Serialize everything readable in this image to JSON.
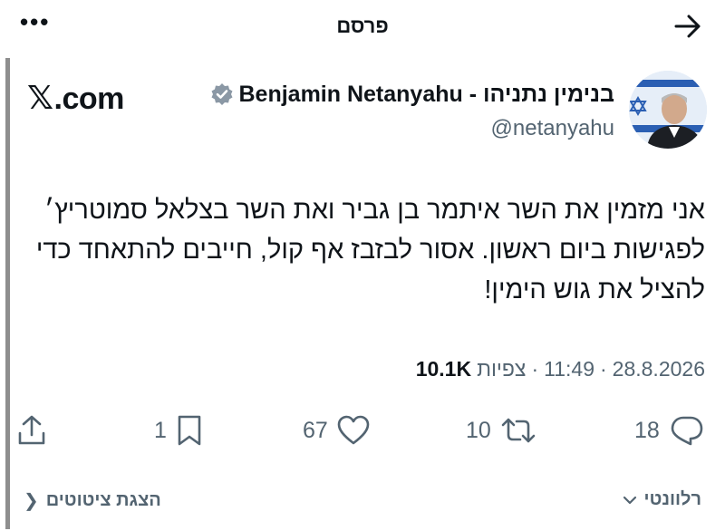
{
  "header": {
    "title": "פרסם",
    "more_icon": "more-horizontal-icon",
    "back_icon": "arrow-right-icon"
  },
  "author": {
    "name": "בנימין נתניהו - Benjamin Netanyahu",
    "handle": "@netanyahu",
    "verified": true,
    "verified_color": "#8b98a5"
  },
  "source": {
    "logo_text": ".com",
    "logo_x": "𝕏"
  },
  "tweet": {
    "lines": [
      "אני מזמין את השר איתמר בן גביר ואת השר בצלאל סמוטריץ׳",
      "לפגישות ביום ראשון. אסור לבזבז אף קול, חייבים להתאחד כדי",
      "להציל את גוש הימין!"
    ]
  },
  "meta": {
    "date": "28.8.2026",
    "time": "11:49",
    "views_count": "10.1K",
    "views_label": "צפיות",
    "separator": "·"
  },
  "actions": {
    "reply_count": "18",
    "retweet_count": "10",
    "like_count": "67",
    "bookmark_count": "1"
  },
  "footer": {
    "relevant_label": "רלוונטי",
    "show_quotes_label": "הצגת ציטוטים"
  },
  "colors": {
    "text": "#0f1419",
    "secondary": "#536471",
    "quote_bar": "#8e8e8e"
  }
}
